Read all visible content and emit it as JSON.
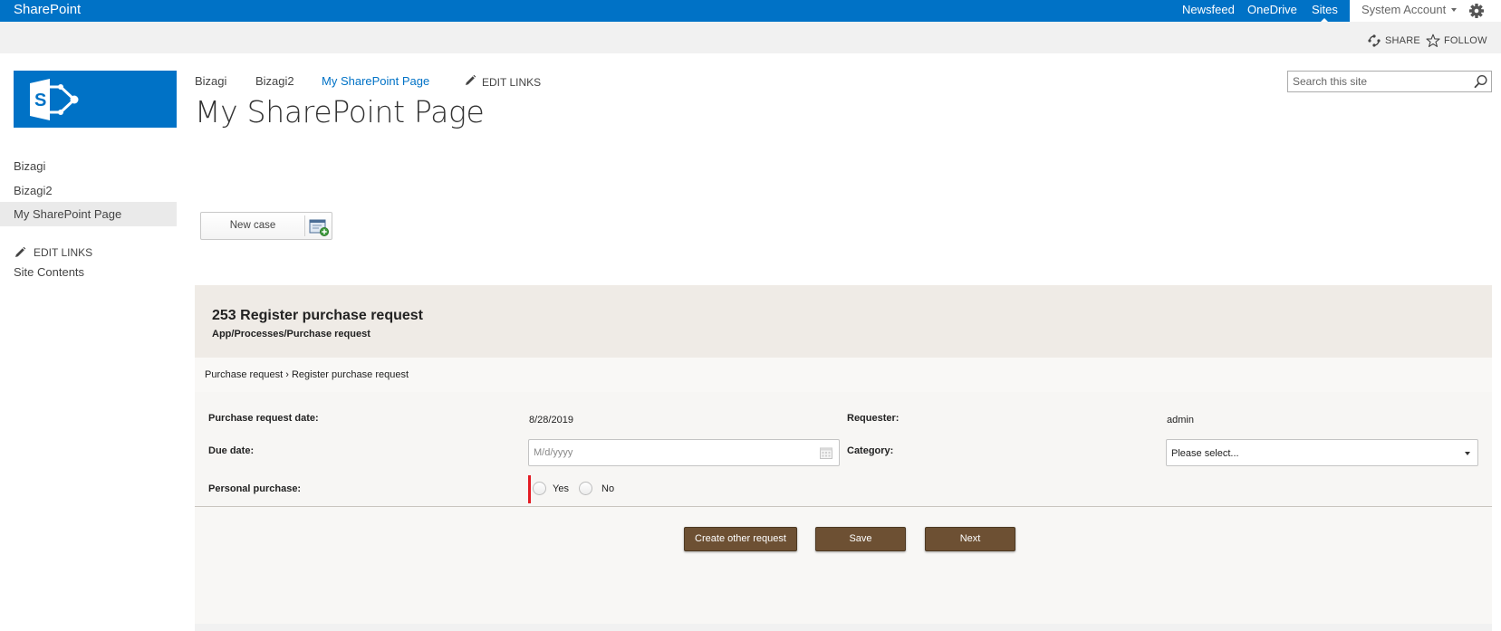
{
  "suite": {
    "brand": "SharePoint",
    "links": [
      "Newsfeed",
      "OneDrive",
      "Sites"
    ],
    "active_link": "Sites",
    "account": "System Account"
  },
  "actions": {
    "share": "SHARE",
    "follow": "FOLLOW"
  },
  "left_nav": {
    "items": [
      "Bizagi",
      "Bizagi2",
      "My SharePoint Page"
    ],
    "selected": "My SharePoint Page",
    "edit_links": "EDIT LINKS",
    "site_contents": "Site Contents"
  },
  "top_nav": {
    "items": [
      "Bizagi",
      "Bizagi2",
      "My SharePoint Page"
    ],
    "current": "My SharePoint Page",
    "edit_links": "EDIT LINKS"
  },
  "page": {
    "title": "My SharePoint Page"
  },
  "search": {
    "placeholder": "Search this site"
  },
  "new_case": {
    "label": "New case"
  },
  "form": {
    "case_title": "253 Register purchase request",
    "case_path": "App/Processes/Purchase request",
    "breadcrumb": "Purchase request › Register purchase request",
    "fields": {
      "purchase_request_date_label": "Purchase request date:",
      "purchase_request_date_value": "8/28/2019",
      "requester_label": "Requester:",
      "requester_value": "admin",
      "due_date_label": "Due date:",
      "due_date_placeholder": "M/d/yyyy",
      "category_label": "Category:",
      "category_value": "Please select...",
      "personal_purchase_label": "Personal purchase:",
      "yes_label": "Yes",
      "no_label": "No"
    },
    "buttons": {
      "create_other": "Create other request",
      "save": "Save",
      "next": "Next"
    }
  },
  "colors": {
    "suite_bar": "#0072c6",
    "link_blue": "#0072c6",
    "form_button": "#6d5033",
    "required": "#e31b23"
  }
}
